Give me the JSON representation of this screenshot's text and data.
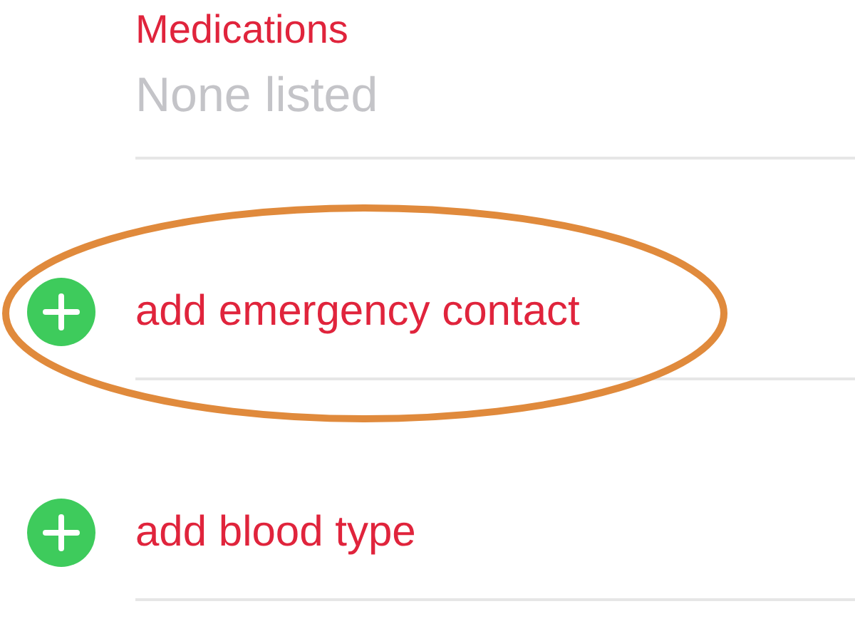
{
  "section": {
    "label": "Medications",
    "value": "None listed"
  },
  "actions": [
    {
      "label": "add emergency contact",
      "highlighted": true
    },
    {
      "label": "add blood type",
      "highlighted": false
    }
  ]
}
